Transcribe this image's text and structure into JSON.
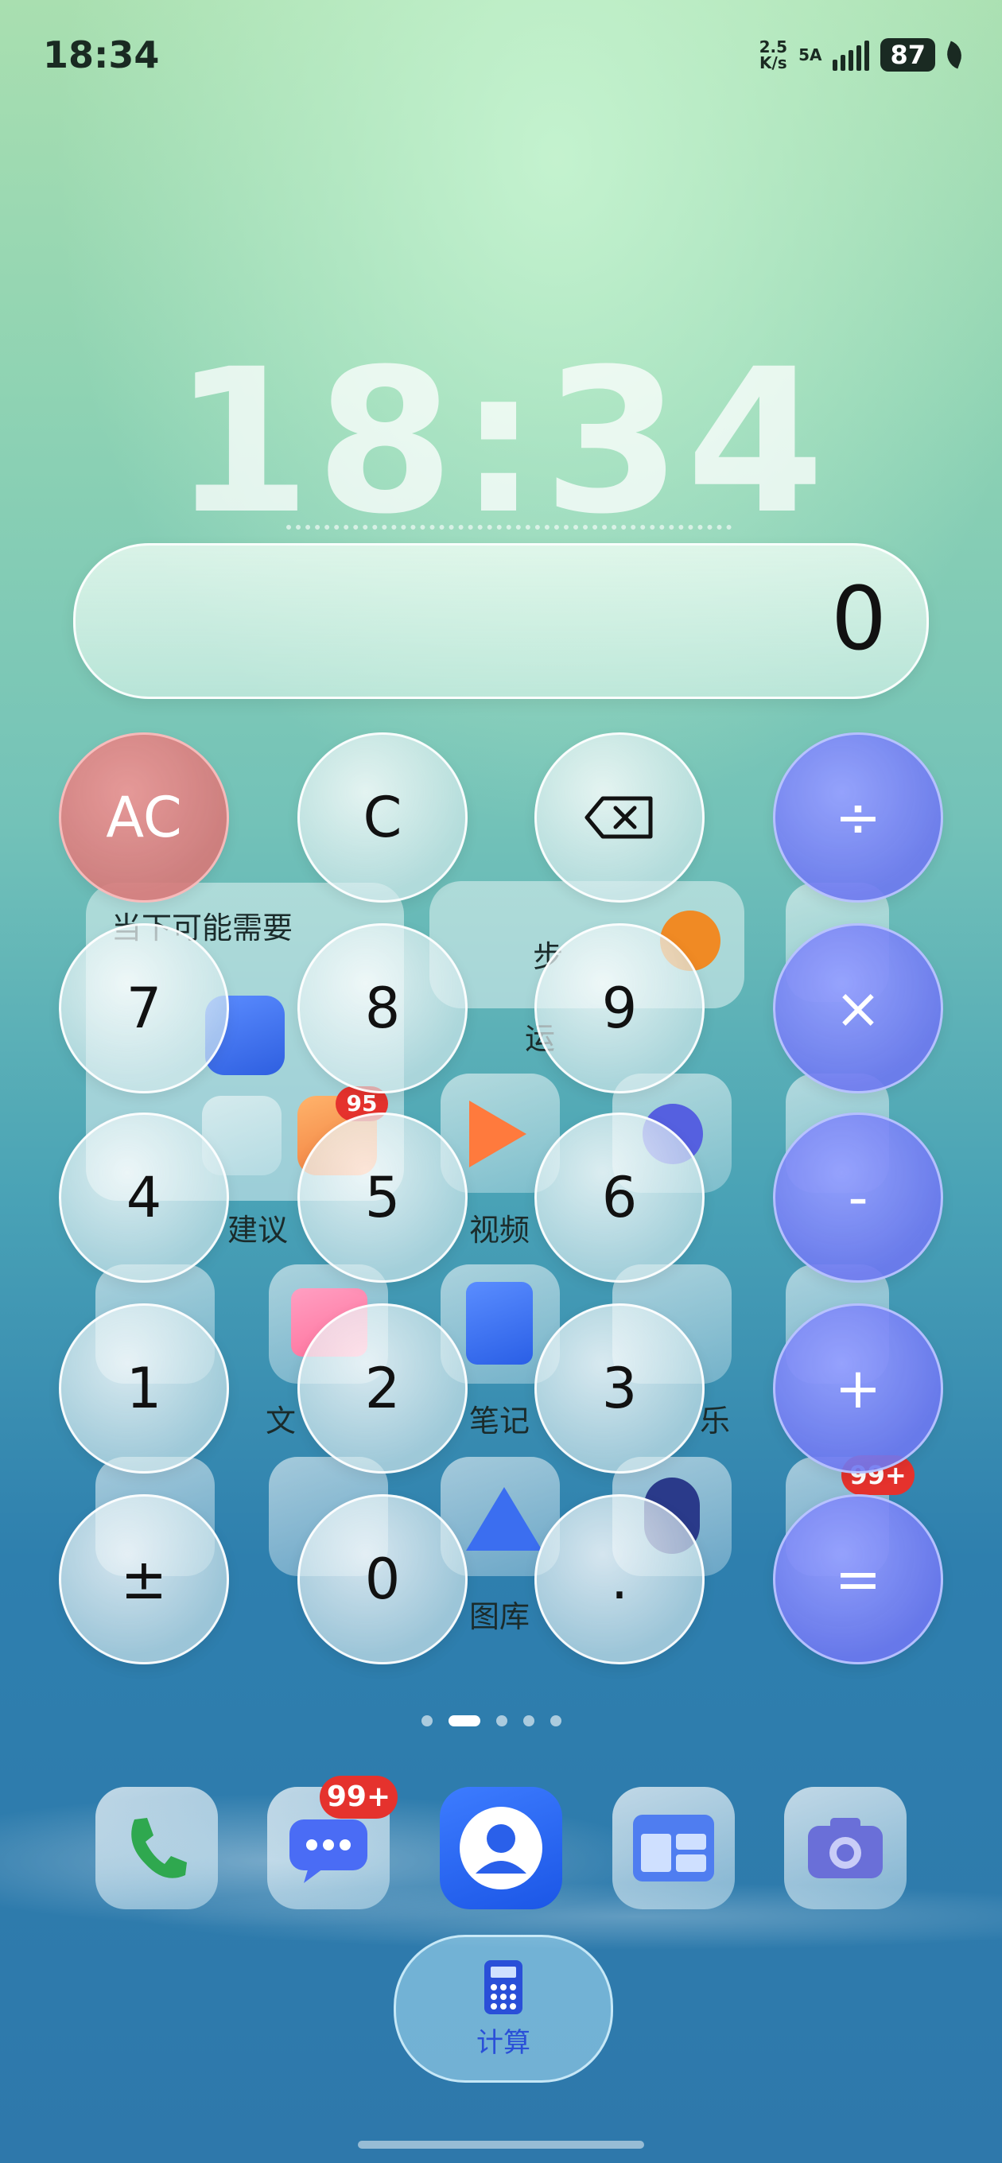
{
  "status_bar": {
    "time": "18:34",
    "net_speed_value": "2.5",
    "net_speed_unit": "K/s",
    "network": "5A",
    "battery": "87"
  },
  "lock_clock": "18:34",
  "home_bg": {
    "widget_title": "当下可能需要",
    "steps_label": "步",
    "steps_sub": "运",
    "labels": [
      "建议",
      "视频",
      "文",
      "笔记",
      "乐",
      "图库"
    ],
    "badge_95": "95",
    "badge_99a": "99+"
  },
  "calculator": {
    "display": "0",
    "keys": {
      "ac": "AC",
      "c": "C",
      "divide": "÷",
      "k7": "7",
      "k8": "8",
      "k9": "9",
      "multiply": "×",
      "k4": "4",
      "k5": "5",
      "k6": "6",
      "minus": "-",
      "k1": "1",
      "k2": "2",
      "k3": "3",
      "plus": "+",
      "sign": "±",
      "k0": "0",
      "dot": ".",
      "equals": "="
    }
  },
  "dock": {
    "messages_badge": "99+",
    "floating_app_label": "计算"
  },
  "colors": {
    "operator_key": "#7d86f5",
    "ac_key": "#e09090",
    "badge": "#e5322d"
  }
}
